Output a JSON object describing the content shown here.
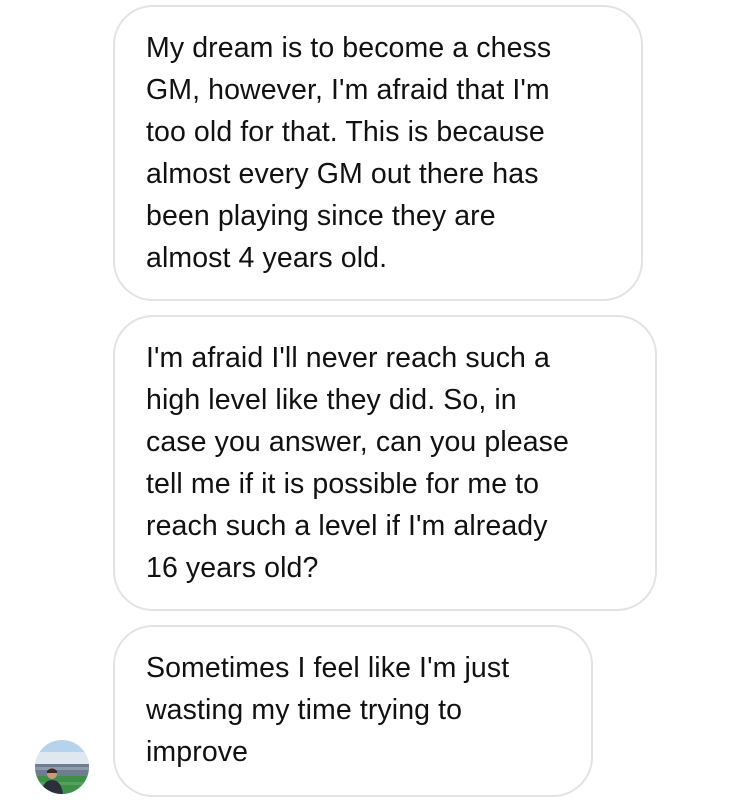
{
  "conversation": {
    "messages": [
      {
        "text": "My dream is to become a chess\nGM, however, I'm afraid that I'm\ntoo old for that. This is because\nalmost every GM out there has\nbeen playing since they are\nalmost 4 years old."
      },
      {
        "text": "I'm afraid I'll never reach such a\nhigh level like they did. So, in\ncase you answer, can you please\ntell me if it is possible for me to\nreach such a level if I'm already\n16 years old?"
      },
      {
        "text": "Sometimes I feel like I'm just\nwasting my time trying to\nimprove"
      }
    ],
    "sender_avatar": {
      "icon": "user-avatar-photo",
      "description_colors": {
        "sky": "#a9c9e6",
        "pitch": "#3f8f4a",
        "stands": "#6b7a8c"
      }
    }
  }
}
